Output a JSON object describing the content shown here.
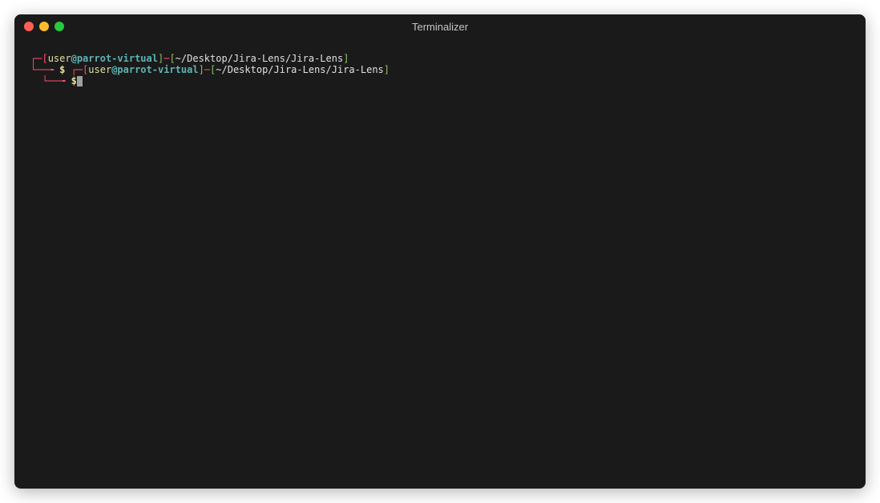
{
  "window": {
    "title": "Terminalizer"
  },
  "prompt1": {
    "corner_top": "┌─[",
    "user": "user",
    "at_host": "@parrot-virtual",
    "bracket_close": "]",
    "dash": "─",
    "bracket_open2": "[",
    "path": "~/Desktop/Jira-Lens/Jira-Lens",
    "bracket_close2": "]",
    "corner_bottom": "└──╼ ",
    "dollar": "$"
  },
  "prompt2": {
    "corner_top": "┌─[",
    "user": "user",
    "at_host": "@parrot-virtual",
    "bracket_close": "]",
    "dash": "─",
    "bracket_open2": "[",
    "path": "~/Desktop/Jira-Lens/Jira-Lens",
    "bracket_close2": "]",
    "corner_bottom": "└──╼ ",
    "dollar": "$"
  }
}
